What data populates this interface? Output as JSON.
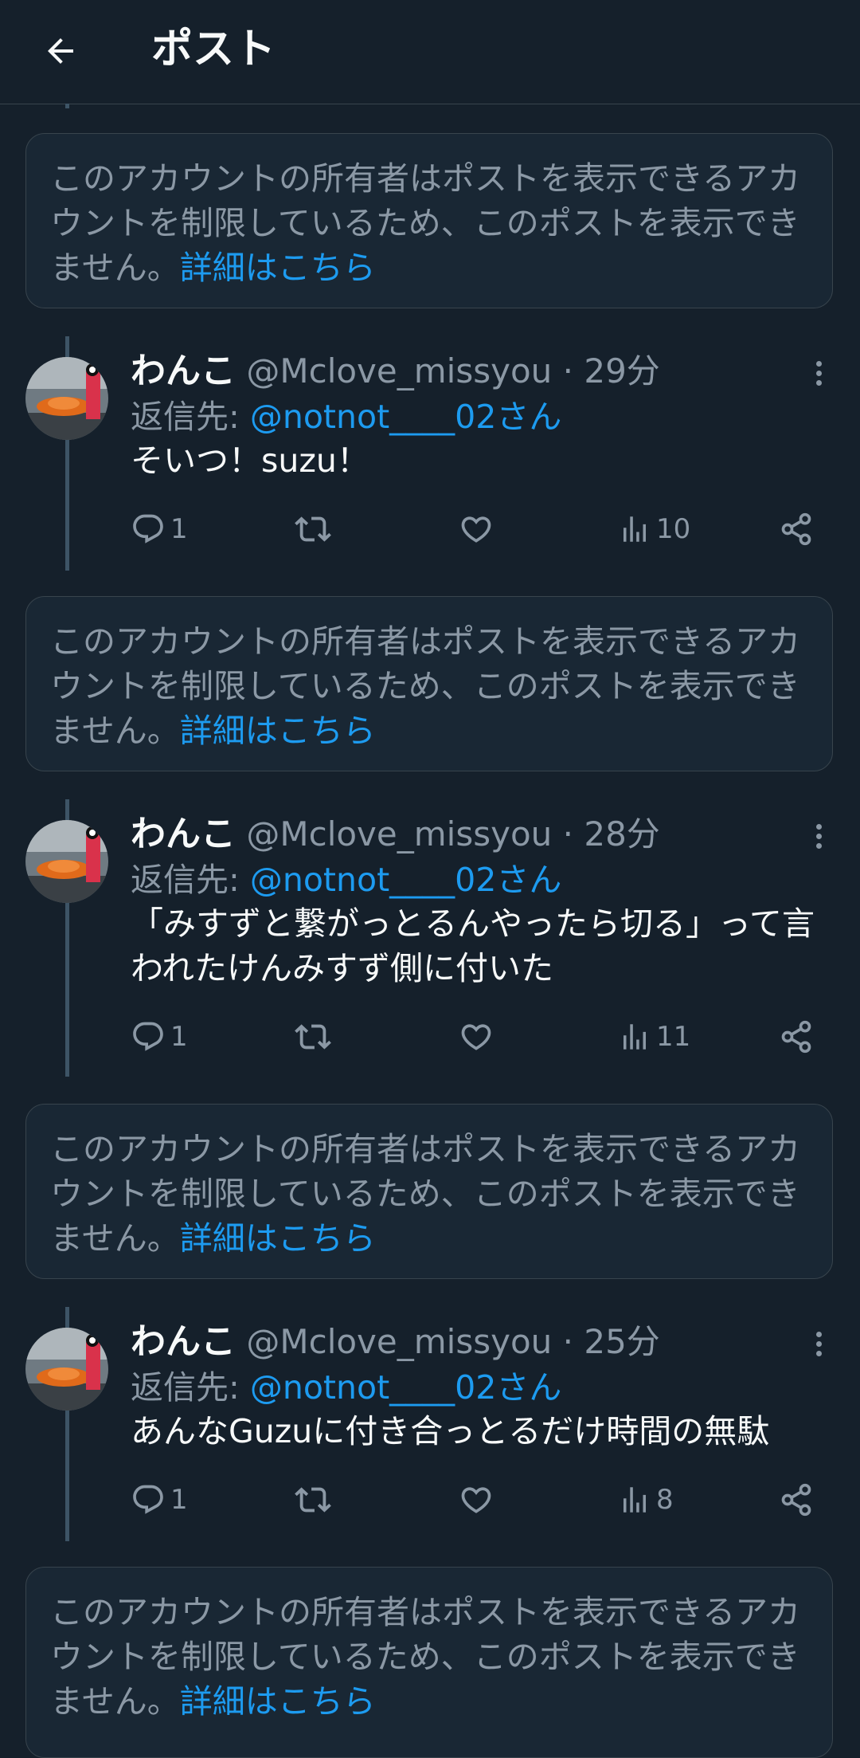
{
  "header": {
    "title": "ポスト",
    "back_icon": "arrow-left-icon"
  },
  "restricted_notice": {
    "text": "このアカウントの所有者はポストを表示できるアカウントを制限しているため、このポストを表示できません。",
    "link": "詳細はこちら"
  },
  "tweets": [
    {
      "name": "わんこ",
      "handle": "@Mclove_missyou",
      "dot": "·",
      "time": "29分",
      "reply_prefix": "返信先: ",
      "reply_to": "@notnot____02さん",
      "text": "そいつ！suzu！",
      "replies": "1",
      "reposts": "",
      "likes": "",
      "views": "10"
    },
    {
      "name": "わんこ",
      "handle": "@Mclove_missyou",
      "dot": "·",
      "time": "28分",
      "reply_prefix": "返信先: ",
      "reply_to": "@notnot____02さん",
      "text": "「みすずと繋がっとるんやったら切る」って言われたけんみすず側に付いた",
      "replies": "1",
      "reposts": "",
      "likes": "",
      "views": "11"
    },
    {
      "name": "わんこ",
      "handle": "@Mclove_missyou",
      "dot": "·",
      "time": "25分",
      "reply_prefix": "返信先: ",
      "reply_to": "@notnot____02さん",
      "text": "あんなGuzuに付き合っとるだけ時間の無駄",
      "replies": "1",
      "reposts": "",
      "likes": "",
      "views": "8"
    }
  ],
  "colors": {
    "background": "#15202b",
    "card": "#192734",
    "border": "#38444d",
    "text_primary": "#f7f9f9",
    "text_secondary": "#8b98a5",
    "accent": "#1d9bf0"
  },
  "icons": [
    "arrow-left-icon",
    "reply-icon",
    "repost-icon",
    "like-icon",
    "views-icon",
    "share-icon",
    "more-icon"
  ]
}
